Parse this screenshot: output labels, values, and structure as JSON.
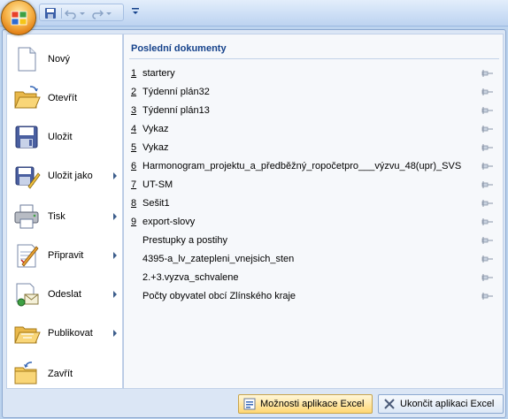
{
  "menu_left": {
    "items": [
      {
        "label": "Nový",
        "icon": "new-document-icon",
        "submenu": false
      },
      {
        "label": "Otevřít",
        "icon": "open-folder-icon",
        "submenu": false
      },
      {
        "label": "Uložit",
        "icon": "save-floppy-icon",
        "submenu": false
      },
      {
        "label": "Uložit jako",
        "icon": "save-as-icon",
        "submenu": true
      },
      {
        "label": "Tisk",
        "icon": "printer-icon",
        "submenu": true
      },
      {
        "label": "Připravit",
        "icon": "prepare-icon",
        "submenu": true
      },
      {
        "label": "Odeslat",
        "icon": "send-icon",
        "submenu": true
      },
      {
        "label": "Publikovat",
        "icon": "publish-icon",
        "submenu": true
      },
      {
        "label": "Zavřít",
        "icon": "close-folder-icon",
        "submenu": false
      }
    ]
  },
  "recent": {
    "header": "Poslední dokumenty",
    "items": [
      {
        "num": "1",
        "name": "startery"
      },
      {
        "num": "2",
        "name": "Týdenní plán32"
      },
      {
        "num": "3",
        "name": "Týdenní plán13"
      },
      {
        "num": "4",
        "name": "Vykaz"
      },
      {
        "num": "5",
        "name": "Vykaz"
      },
      {
        "num": "6",
        "name": "Harmonogram_projektu_a_předběžný_ropočetpro___výzvu_48(upr)_SVS"
      },
      {
        "num": "7",
        "name": "UT-SM"
      },
      {
        "num": "8",
        "name": "Sešit1"
      },
      {
        "num": "9",
        "name": "export-slovy"
      },
      {
        "num": "",
        "name": "Prestupky a postihy"
      },
      {
        "num": "",
        "name": "4395-a_lv_zatepleni_vnejsich_sten"
      },
      {
        "num": "",
        "name": "2.+3.vyzva_schvalene"
      },
      {
        "num": "",
        "name": "Počty obyvatel obcí Zlínského kraje"
      }
    ]
  },
  "footer": {
    "options_label": "Možnosti aplikace Excel",
    "exit_label": "Ukončit aplikaci Excel"
  },
  "colors": {
    "accent": "#15428b",
    "hover": "#ffd773"
  }
}
